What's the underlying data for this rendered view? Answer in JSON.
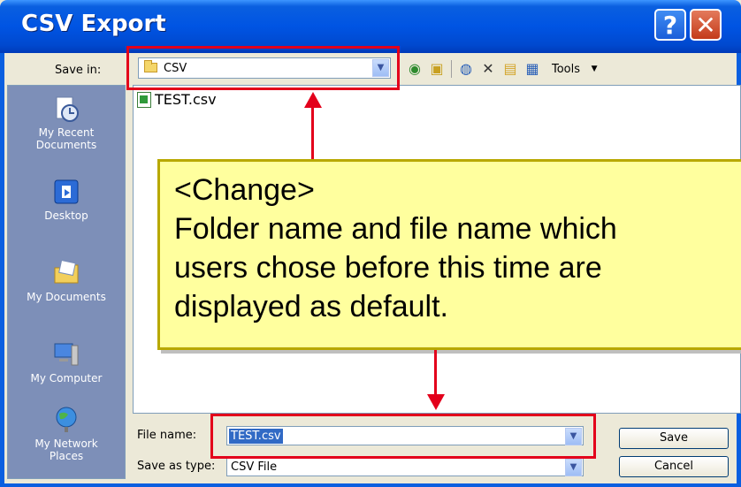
{
  "window": {
    "title": "CSV Export"
  },
  "title_buttons": {
    "help": "?",
    "close": "✕"
  },
  "toolbar": {
    "save_in_label": "Save in:",
    "save_in_value": "CSV",
    "tools_label": "Tools"
  },
  "places": [
    {
      "label": "My Recent\nDocuments",
      "icon": "recent-documents-icon"
    },
    {
      "label": "Desktop",
      "icon": "desktop-icon"
    },
    {
      "label": "My Documents",
      "icon": "my-documents-icon"
    },
    {
      "label": "My Computer",
      "icon": "my-computer-icon"
    },
    {
      "label": "My Network\nPlaces",
      "icon": "network-places-icon"
    }
  ],
  "files": [
    {
      "name": "TEST.csv"
    }
  ],
  "file_name": {
    "label": "File name:",
    "value": "TEST.csv"
  },
  "save_type": {
    "label": "Save as type:",
    "value": "CSV File"
  },
  "buttons": {
    "save": "Save",
    "cancel": "Cancel"
  },
  "callout": {
    "text": "<Change>\nFolder name and file name which\nusers chose before this time are\ndisplayed as default."
  },
  "colors": {
    "title_blue": "#0054e3",
    "highlight_red": "#e3001b",
    "callout_yellow": "#ffff9e"
  }
}
